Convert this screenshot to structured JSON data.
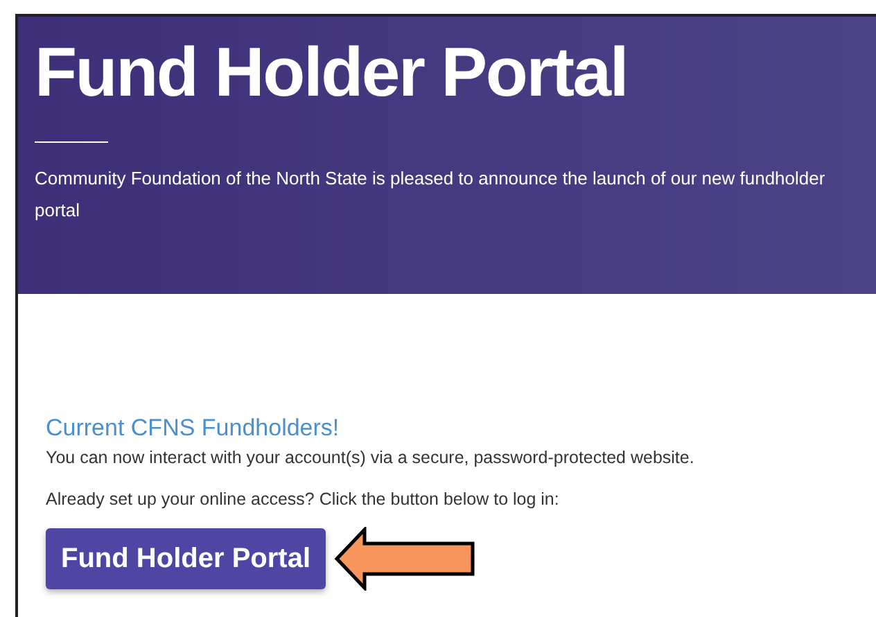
{
  "header": {
    "title": "Fund Holder Portal",
    "description_lines": [
      "Community Foundation of the North State is pleased to announce the launch of our new fundholder",
      "portal"
    ]
  },
  "section": {
    "heading": "Current CFNS Fundholders!",
    "paragraphs": [
      "You can now interact with your account(s) via a secure, password-protected website.",
      "Already set up your online access? Click the button below to log in:"
    ],
    "button": "Fund Holder Portal"
  }
}
